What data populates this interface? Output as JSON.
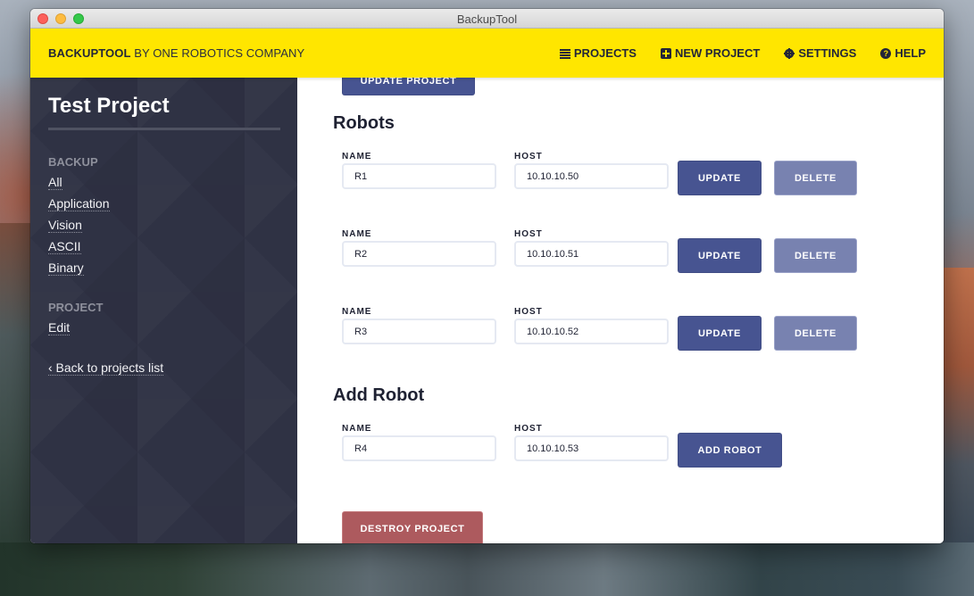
{
  "window": {
    "title": "BackupTool"
  },
  "topnav": {
    "brand_bold": "BACKUPTOOL",
    "brand_rest": " BY ONE ROBOTICS COMPANY",
    "links": [
      {
        "label": "PROJECTS",
        "icon": "list-icon"
      },
      {
        "label": "NEW PROJECT",
        "icon": "plus-square-icon"
      },
      {
        "label": "SETTINGS",
        "icon": "gear-icon"
      },
      {
        "label": "HELP",
        "icon": "question-circle-icon"
      }
    ]
  },
  "sidebar": {
    "title": "Test Project",
    "backup_section": "BACKUP",
    "backup_links": [
      "All",
      "Application",
      "Vision",
      "ASCII",
      "Binary"
    ],
    "project_section": "PROJECT",
    "project_links": [
      "Edit"
    ],
    "back_link": "‹ Back to projects list"
  },
  "main": {
    "update_project_label": "UPDATE PROJECT",
    "robots_heading": "Robots",
    "name_label": "NAME",
    "host_label": "HOST",
    "update_label": "UPDATE",
    "delete_label": "DELETE",
    "robots": [
      {
        "name": "R1",
        "host": "10.10.10.50"
      },
      {
        "name": "R2",
        "host": "10.10.10.51"
      },
      {
        "name": "R3",
        "host": "10.10.10.52"
      }
    ],
    "add_heading": "Add Robot",
    "new_robot": {
      "name": "R4",
      "host": "10.10.10.53"
    },
    "add_robot_label": "ADD ROBOT",
    "destroy_label": "DESTROY PROJECT"
  },
  "colors": {
    "accent_yellow": "#ffe600",
    "primary": "#475491",
    "muted": "#7882b0",
    "danger": "#ad5a5e",
    "sidebar_bg": "#2f3244"
  }
}
